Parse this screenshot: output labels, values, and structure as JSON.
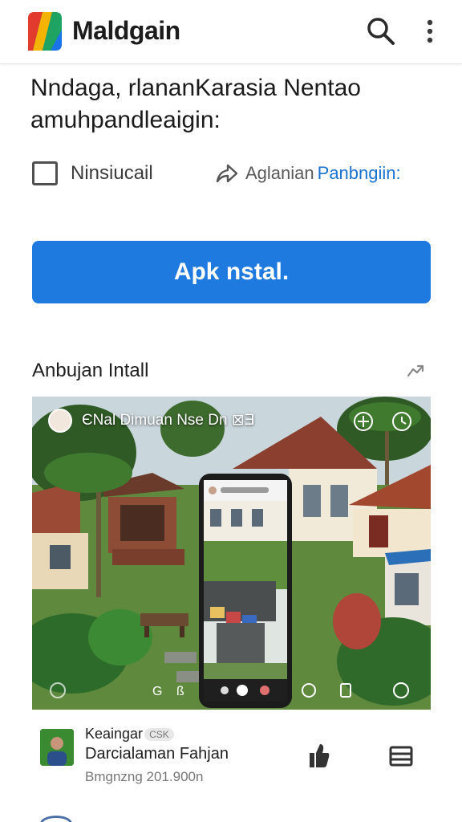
{
  "header": {
    "app_title": "Maldgain",
    "logo_colors": [
      "#e23b2e",
      "#f5b400",
      "#1ea362",
      "#1a73e8"
    ],
    "search_icon": "search-icon",
    "more_icon": "more-vert-icon"
  },
  "main": {
    "headline": "Nndaga, rlananKarasia Nentao amuhpandleaigin:",
    "checkbox_label": "Ninsiucail",
    "share_text": "Aglanian",
    "share_link": "Panbngiin:",
    "install_label": "Apk nstal.",
    "accent_color": "#1f7ae0"
  },
  "section": {
    "title": "Anbujan Intall",
    "arrow_icon": "share-arrow-icon"
  },
  "media": {
    "caption": "ЄNal Dimuan Nse Dn ⊠Ǝ"
  },
  "item": {
    "name": "Keaingar",
    "tag": "CSK",
    "title": "Darcialaman Fahjan",
    "date": "Bmgnzng 201.900n",
    "like_icon": "thumb-up-icon",
    "save_icon": "bookmark-icon"
  }
}
